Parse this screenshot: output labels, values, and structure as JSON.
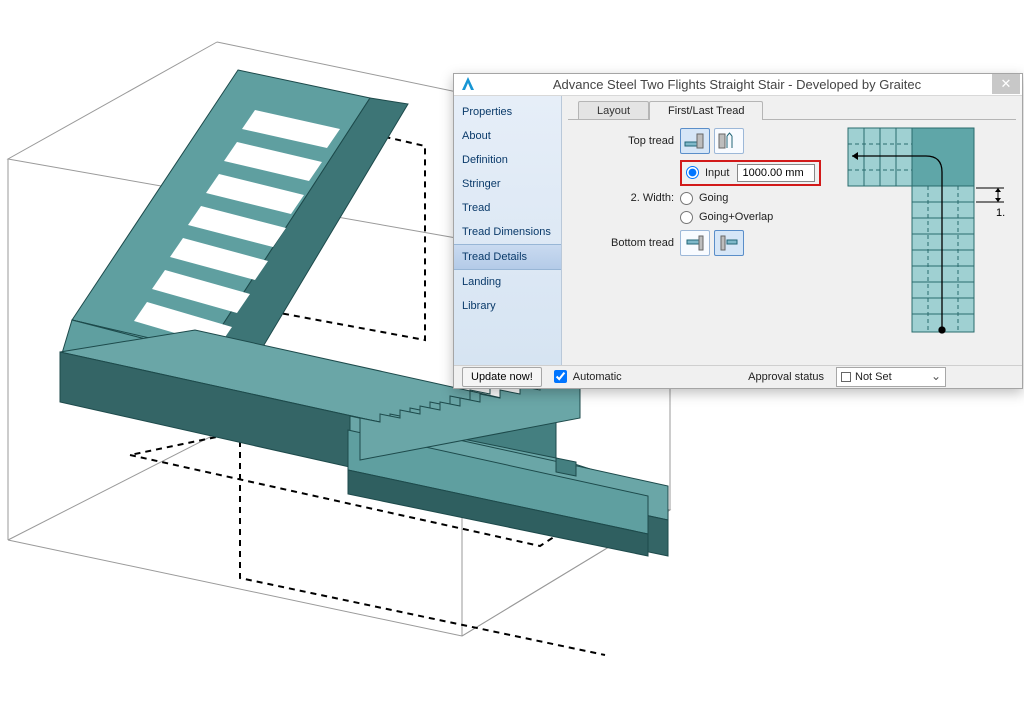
{
  "dialog": {
    "title": "Advance Steel   Two Flights Straight Stair - Developed by Graitec",
    "sidebar": {
      "items": [
        {
          "label": "Properties"
        },
        {
          "label": "About"
        },
        {
          "label": "Definition"
        },
        {
          "label": "Stringer"
        },
        {
          "label": "Tread"
        },
        {
          "label": "Tread Dimensions"
        },
        {
          "label": "Tread Details"
        },
        {
          "label": "Landing"
        },
        {
          "label": "Library"
        }
      ],
      "selected_index": 6
    },
    "tabs": {
      "layout": "Layout",
      "first_last": "First/Last Tread"
    },
    "form": {
      "top_tread_label": "Top tread",
      "width_label": "2. Width:",
      "input_label": "Input",
      "input_value": "1000.00 mm",
      "going_label": "Going",
      "going_overlap_label": "Going+Overlap",
      "bottom_tread_label": "Bottom tread"
    },
    "plan": {
      "dim1_label": "1."
    },
    "footer": {
      "update_label": "Update now!",
      "automatic_label": "Automatic",
      "approval_label": "Approval status",
      "approval_value": "Not Set"
    }
  }
}
